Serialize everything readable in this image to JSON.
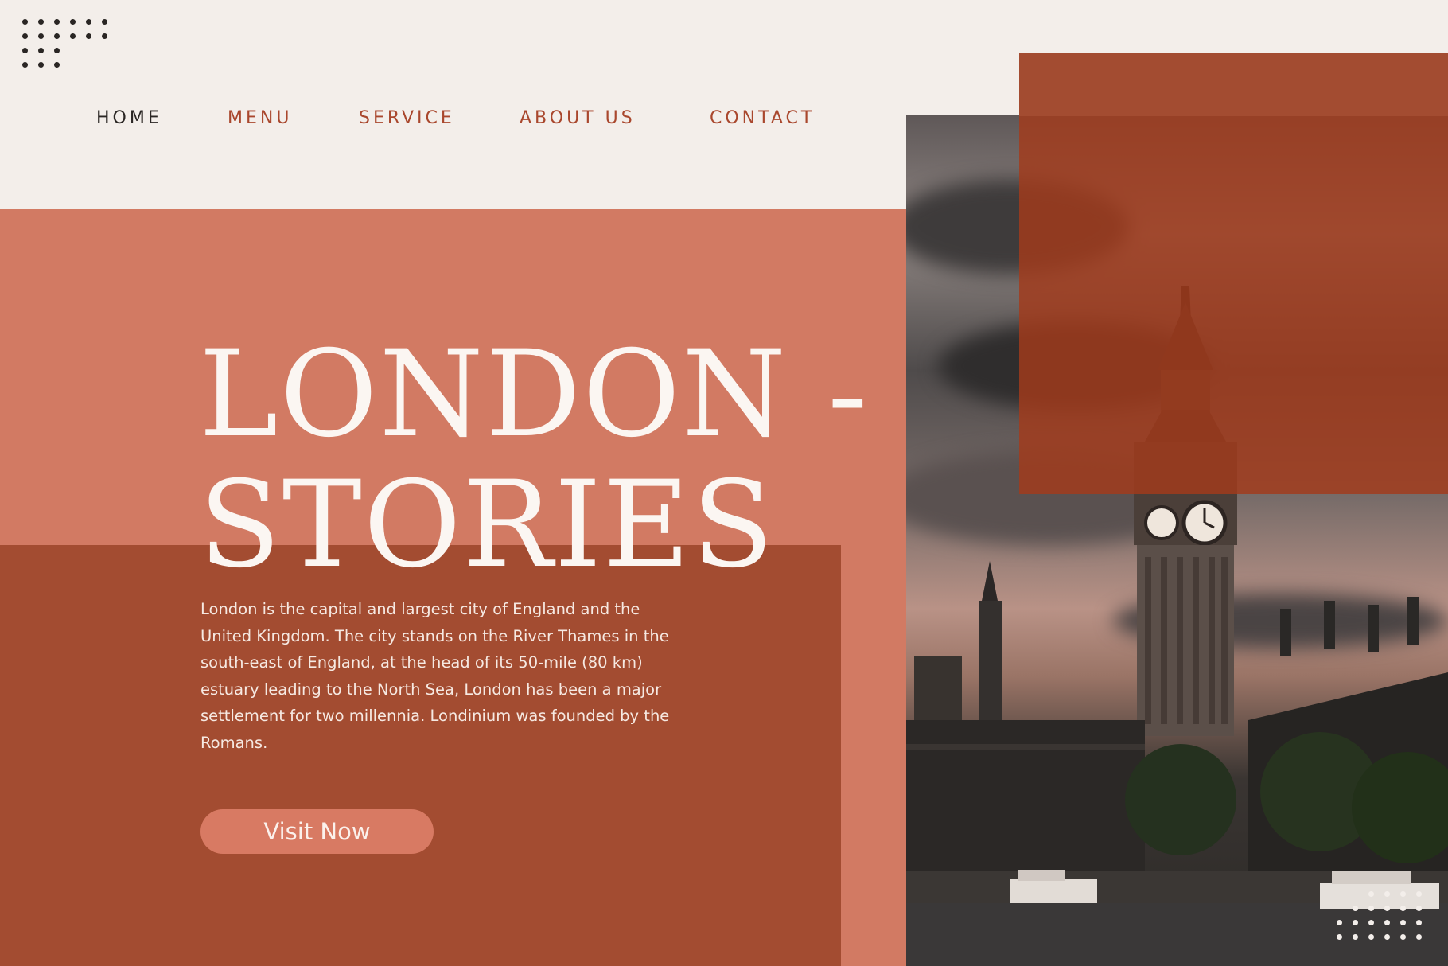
{
  "nav": {
    "items": [
      {
        "label": "HOME",
        "active": true
      },
      {
        "label": "MENU",
        "active": false
      },
      {
        "label": "SERVICE",
        "active": false
      },
      {
        "label": "ABOUT US",
        "active": false
      },
      {
        "label": "CONTACT",
        "active": false
      }
    ]
  },
  "hero": {
    "title_line1": "LONDON -",
    "title_line2": "STORIES",
    "description": "London is the capital and largest city of England and the United Kingdom. The city stands on the River Thames in the south-east of England, at the head of its 50-mile (80 km) estuary leading to the North Sea, London has been a major settlement for two millennia. Londinium was founded by the Romans.",
    "cta_label": "Visit Now"
  },
  "colors": {
    "background": "#f3eeea",
    "salmon": "#d27a63",
    "rust": "#a34c31",
    "nav_accent": "#a9472d",
    "nav_active": "#2a2624"
  },
  "decor": {
    "top_left": "dot-grid-icon",
    "bottom_right": "dot-grid-icon"
  },
  "image": {
    "subject": "big-ben-photo"
  }
}
